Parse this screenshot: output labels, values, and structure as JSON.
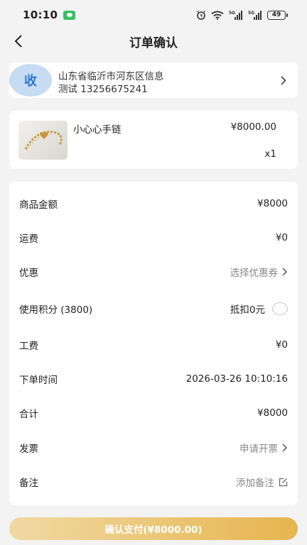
{
  "status_bar": {
    "time": "10:10",
    "battery": "49"
  },
  "nav": {
    "title": "订单确认"
  },
  "address": {
    "avatar_text": "收",
    "line1": "山东省临沂市河东区信息",
    "line2": "测试 13256675241"
  },
  "product": {
    "name": "小心心手链",
    "price": "¥8000.00",
    "qty": "x1"
  },
  "details": {
    "goods_amount_label": "商品金额",
    "goods_amount": "¥8000",
    "shipping_label": "运费",
    "shipping": "¥0",
    "discount_label": "优惠",
    "discount_action": "选择优惠券",
    "points_label": "使用积分 (3800)",
    "points_deduct": "抵扣0元",
    "labor_label": "工费",
    "labor": "¥0",
    "order_time_label": "下单时间",
    "order_time": "2026-03-26 10:10:16",
    "total_label": "合计",
    "total": "¥8000",
    "invoice_label": "发票",
    "invoice_action": "申请开票",
    "remark_label": "备注",
    "remark_action": "添加备注"
  },
  "pay_button": "确认支付(¥8000.00)",
  "colors": {
    "accent_gold": "#e6b54e",
    "avatar_bg": "#c7dbf3",
    "avatar_text": "#2c74d3"
  }
}
